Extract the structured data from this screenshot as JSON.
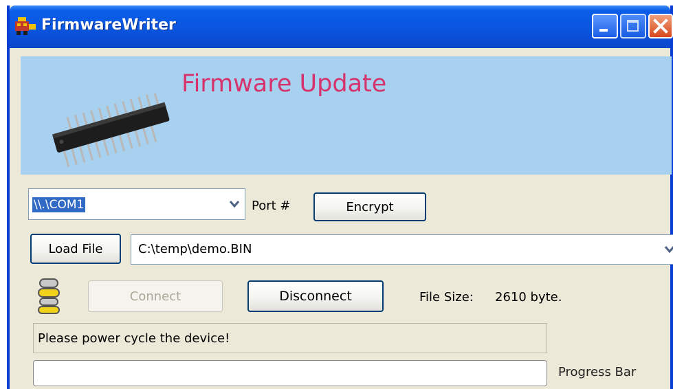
{
  "window": {
    "title": "FirmwareWriter",
    "icon": "app-icon",
    "controls": [
      "minimize-icon",
      "maximize-icon",
      "close-icon"
    ]
  },
  "banner": {
    "title": "Firmware Update",
    "image": "ic-chip-image",
    "background_color": "#a7d1ef",
    "title_color": "#d6336c"
  },
  "port": {
    "selected": "\\\\.\\COM1",
    "label": "Port #"
  },
  "buttons": {
    "encrypt": "Encrypt",
    "load_file": "Load File",
    "connect": "Connect",
    "disconnect": "Disconnect"
  },
  "file": {
    "path": "C:\\temp\\demo.BIN"
  },
  "file_size": {
    "label": "File Size:",
    "value": "2610 byte."
  },
  "status": {
    "message": "Please power cycle the device!"
  },
  "progress": {
    "label": "Progress Bar",
    "value": 0
  }
}
